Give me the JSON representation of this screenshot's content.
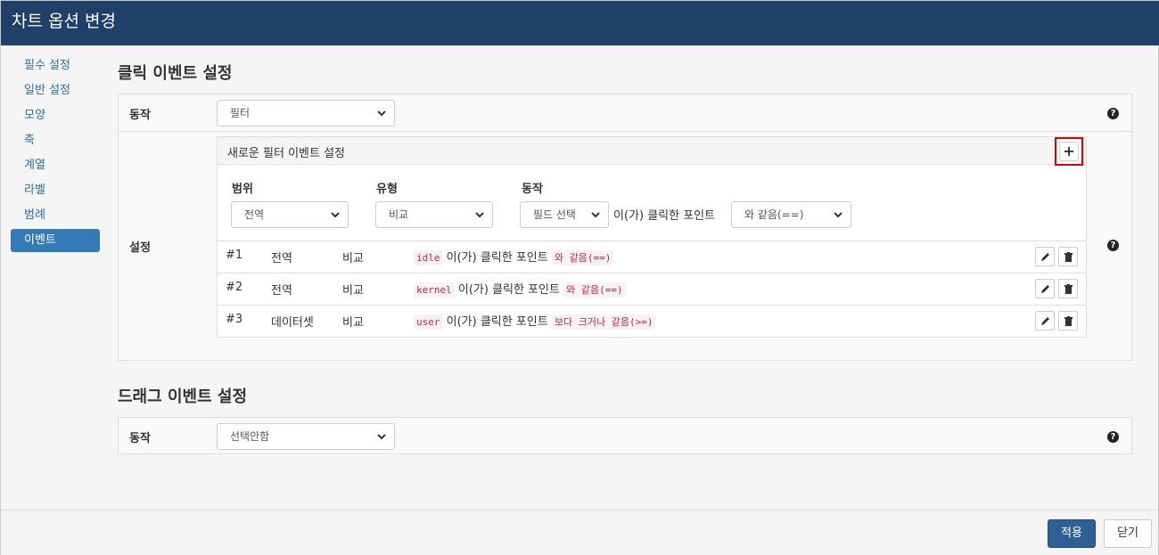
{
  "window": {
    "title": "차트 옵션 변경"
  },
  "sidebar": {
    "items": [
      {
        "label": "필수 설정"
      },
      {
        "label": "일반 설정"
      },
      {
        "label": "모양"
      },
      {
        "label": "축"
      },
      {
        "label": "계열"
      },
      {
        "label": "라벨"
      },
      {
        "label": "범례"
      },
      {
        "label": "이벤트",
        "active": true
      }
    ]
  },
  "click_section": {
    "title": "클릭 이벤트 설정",
    "action_label": "동작",
    "action_value": "필터",
    "settings_label": "설정",
    "filter_panel": {
      "header": "새로운 필터 이벤트 설정",
      "add_label": "+",
      "scope_label": "범위",
      "type_label": "유형",
      "action_label": "동작",
      "scope_value": "전역",
      "type_value": "비교",
      "field_value": "필드 선택",
      "middle_text": "이(가) 클릭한 포인트",
      "operator_value": "와 같음(==)"
    },
    "rules": [
      {
        "index": "#1",
        "scope": "전역",
        "type": "비교",
        "field": "idle",
        "text": "이(가) 클릭한 포인트",
        "op": "와 같음(==)"
      },
      {
        "index": "#2",
        "scope": "전역",
        "type": "비교",
        "field": "kernel",
        "text": "이(가) 클릭한 포인트",
        "op": "와 같음(==)"
      },
      {
        "index": "#3",
        "scope": "데이터셋",
        "type": "비교",
        "field": "user",
        "text": "이(가) 클릭한 포인트",
        "op": "보다 크거나 같음(>=)"
      }
    ]
  },
  "drag_section": {
    "title": "드래그 이벤트 설정",
    "action_label": "동작",
    "action_value": "선택안함"
  },
  "help_icon": "?",
  "footer": {
    "apply_label": "적용",
    "close_label": "닫기"
  },
  "colors": {
    "titlebar": "#1f4068",
    "primary": "#2e6095",
    "highlight": "#e00000",
    "code": "#c7254e"
  }
}
